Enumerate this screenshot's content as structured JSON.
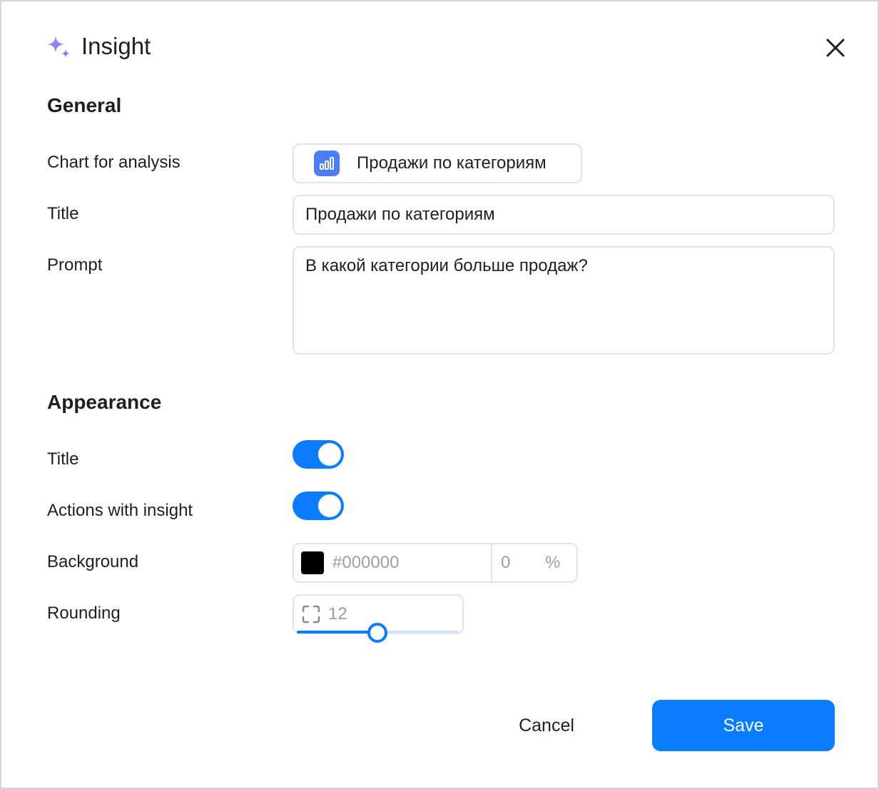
{
  "dialog": {
    "title": "Insight",
    "icon": "sparkle-icon",
    "close_icon": "close-icon"
  },
  "general": {
    "section_title": "General",
    "chart_label": "Chart for analysis",
    "chart_value": "Продажи по категориям",
    "chart_icon": "bar-chart-icon",
    "title_label": "Title",
    "title_value": "Продажи по категориям",
    "prompt_label": "Prompt",
    "prompt_value": "В какой категории больше продаж?"
  },
  "appearance": {
    "section_title": "Appearance",
    "title_toggle_label": "Title",
    "title_toggle_on": true,
    "actions_toggle_label": "Actions with insight",
    "actions_toggle_on": true,
    "background_label": "Background",
    "background_color": "#000000",
    "background_hex_placeholder": "#000000",
    "background_opacity_placeholder": "0",
    "background_opacity_unit": "%",
    "rounding_label": "Rounding",
    "rounding_icon": "corner-radius-icon",
    "rounding_value": "12",
    "rounding_slider_fraction": 0.5
  },
  "footer": {
    "cancel_label": "Cancel",
    "save_label": "Save"
  },
  "colors": {
    "accent": "#0a7cff",
    "chart_icon_bg": "#4d7cf7",
    "sparkle_gradient_start": "#c17bf3",
    "sparkle_gradient_end": "#6f7ff7"
  }
}
